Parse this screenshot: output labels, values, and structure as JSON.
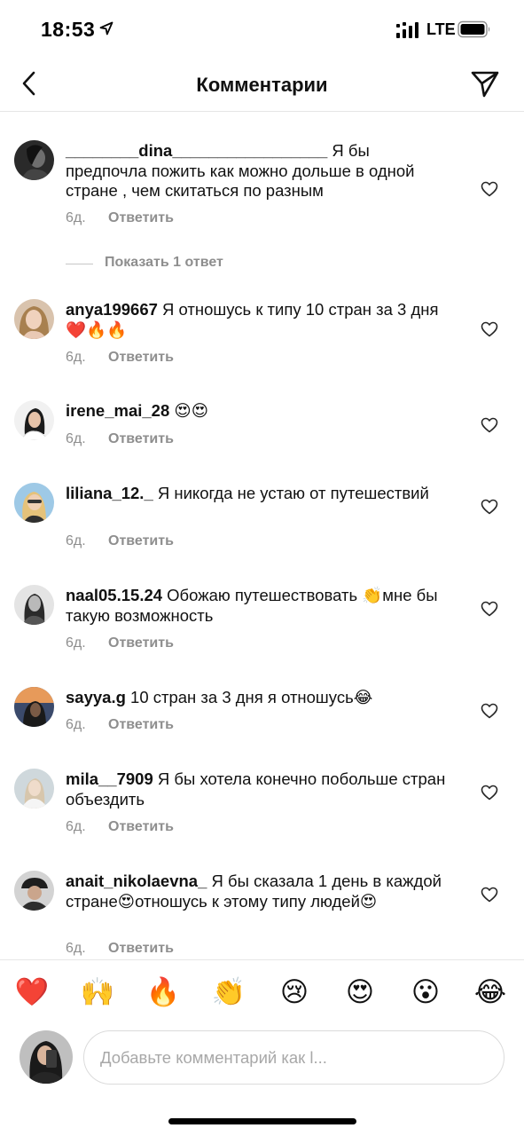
{
  "status_bar": {
    "time": "18:53",
    "network": "LTE"
  },
  "header": {
    "title": "Комментарии"
  },
  "comments": [
    {
      "username": "________dina_________________",
      "text": " Я бы предпочла пожить как можно дольше в одной стране , чем скитаться по разным",
      "time": "6д.",
      "reply_label": "Ответить",
      "show_replies": "Показать 1 ответ"
    },
    {
      "username": "anya199667",
      "text": " Я отношусь к типу 10 стран за 3 дня❤️🔥🔥",
      "time": "6д.",
      "reply_label": "Ответить"
    },
    {
      "username": "irene_mai_28",
      "text": " 😍😍",
      "time": "6д.",
      "reply_label": "Ответить"
    },
    {
      "username": "liliana_12._",
      "text": " Я никогда не устаю от путешествий",
      "time": "6д.",
      "reply_label": "Ответить"
    },
    {
      "username": "naal05.15.24",
      "text": " Обожаю путешествовать 👏мне бы такую возможность",
      "time": "6д.",
      "reply_label": "Ответить"
    },
    {
      "username": "sayya.g",
      "text": " 10 стран за 3 дня я отношусь😂",
      "time": "6д.",
      "reply_label": "Ответить"
    },
    {
      "username": "mila__7909",
      "text": " Я бы хотела конечно побольше стран объездить",
      "time": "6д.",
      "reply_label": "Ответить"
    },
    {
      "username": "anait_nikolaevna_",
      "text": " Я бы сказала 1 день в каждой стране😍отношусь к этому типу людей😍",
      "time": "6д.",
      "reply_label": "Ответить"
    }
  ],
  "emoji_bar": [
    "❤️",
    "🙌",
    "🔥",
    "👏",
    "😢",
    "😍",
    "😮",
    "😂"
  ],
  "composer": {
    "placeholder": "Добавьте комментарий как l..."
  },
  "icons": {
    "back": "chevron-left-icon",
    "send": "paper-plane-icon",
    "like": "heart-outline-icon",
    "location": "location-arrow-icon",
    "signal": "cellular-signal-icon",
    "battery": "battery-icon"
  },
  "colors": {
    "secondary_text": "#8e8e8e",
    "divider": "#e6e6e6",
    "primary_text": "#111111"
  }
}
